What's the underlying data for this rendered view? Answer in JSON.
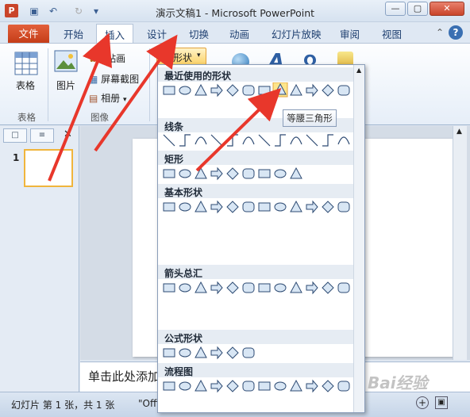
{
  "app_title": "演示文稿1 - Microsoft PowerPoint",
  "tabs": {
    "file": "文件",
    "items": [
      "开始",
      "插入",
      "设计",
      "切换",
      "动画",
      "幻灯片放映",
      "审阅",
      "视图"
    ]
  },
  "ribbon": {
    "table_label": "表格",
    "table_group": "表格",
    "picture_label": "图片",
    "clipart_label": "剪贴画",
    "screenshot_label": "屏幕截图",
    "album_label": "相册",
    "image_group": "图像",
    "shapes_label": "形状"
  },
  "dropdown": {
    "sections": [
      "最近使用的形状",
      "线条",
      "矩形",
      "基本形状",
      "箭头总汇",
      "公式形状",
      "流程图"
    ],
    "tooltip": "等腰三角形"
  },
  "slides_panel": {
    "slide_number": "1"
  },
  "notes_placeholder": "单击此处添加",
  "status": {
    "slide_info": "幻灯片 第 1 张，共 1 张",
    "theme": "\"Offi"
  },
  "watermark": "Bai经验",
  "colors": {
    "accent": "#c53d18",
    "arrow": "#e8372b",
    "shape_fill": "#d8e6f4",
    "shape_stroke": "#2e4b73"
  }
}
